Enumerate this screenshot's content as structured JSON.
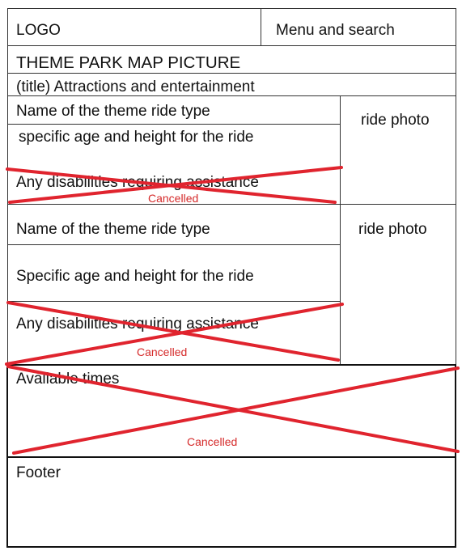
{
  "header": {
    "logo": "LOGO",
    "menu_search": "Menu and search"
  },
  "map_title": "THEME PARK MAP PICTURE",
  "section_title": "(title) Attractions and entertainment",
  "rides": [
    {
      "name": "Name of the theme ride type",
      "requirements": "specific age and height for the ride",
      "disabilities": "Any disabilities requiring assistance",
      "disabilities_status": "Cancelled",
      "photo": "ride photo"
    },
    {
      "name": "Name of the theme ride type",
      "requirements": "Specific age and height for the ride",
      "disabilities": "Any disabilities requiring assistance",
      "disabilities_status": "Cancelled",
      "photo": "ride photo"
    }
  ],
  "available_times": {
    "label": "Available times",
    "status": "Cancelled"
  },
  "footer": {
    "label": "Footer"
  },
  "colors": {
    "cancel_mark": "#e0242e",
    "cancel_text": "#d52a2a",
    "border": "#222222"
  }
}
